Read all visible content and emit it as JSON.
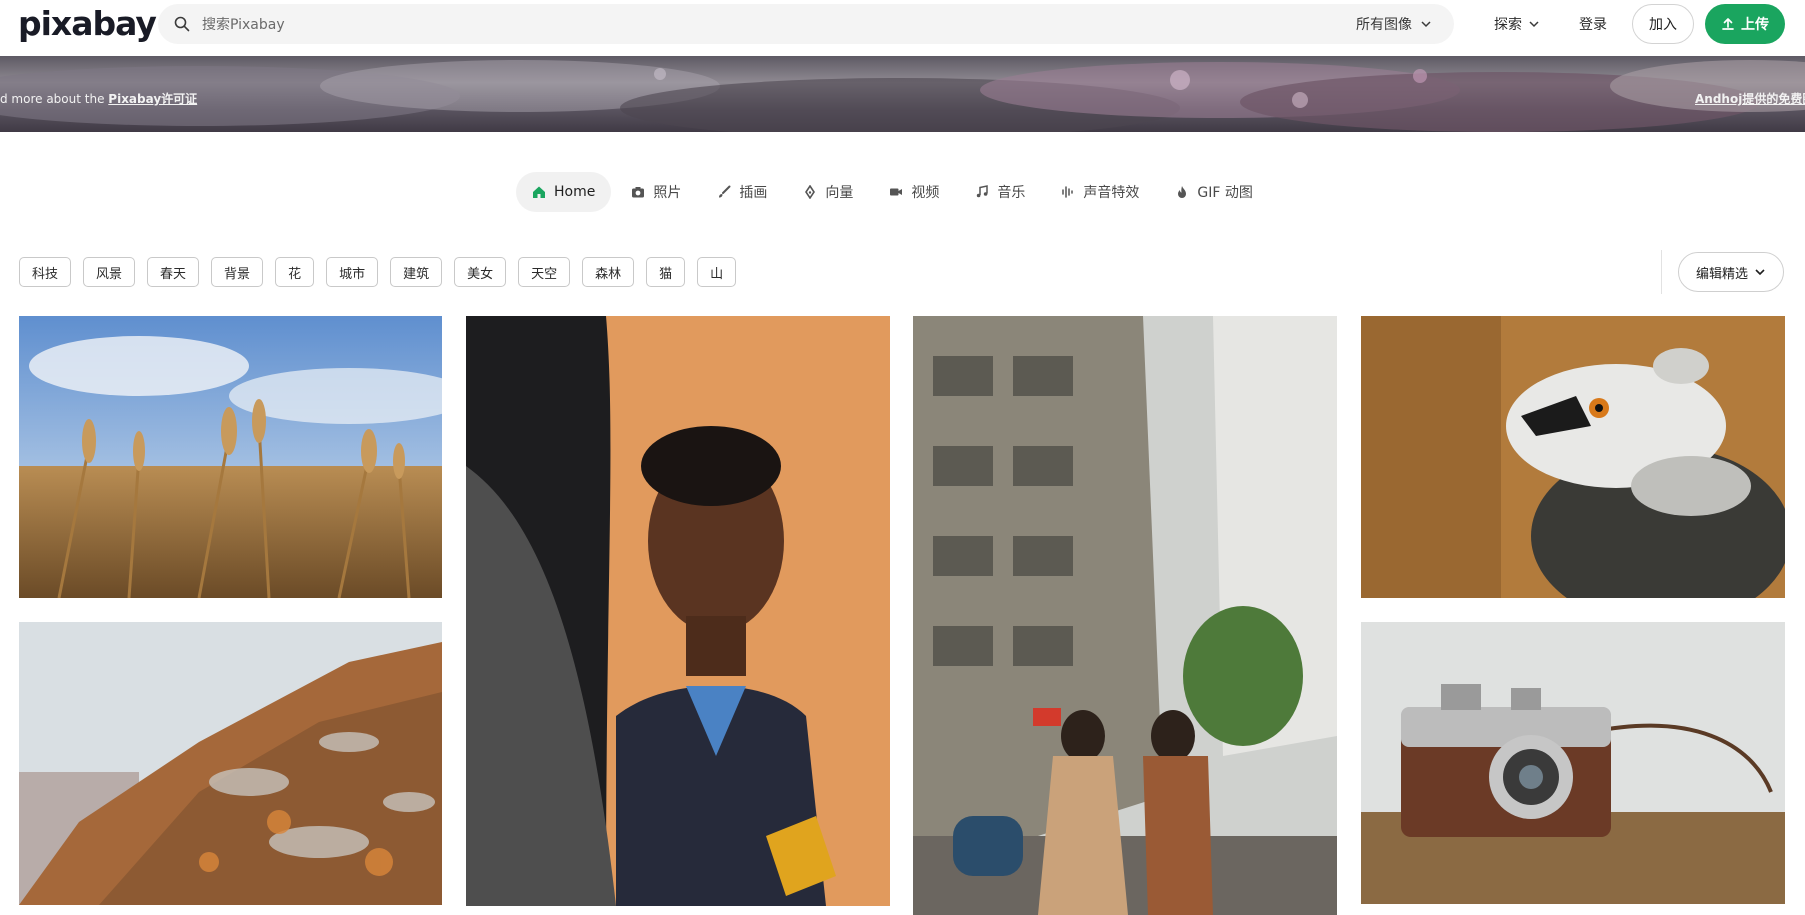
{
  "header": {
    "logo": "pixabay",
    "search_placeholder": "搜索Pixabay",
    "filter_label": "所有图像",
    "explore_label": "探索",
    "login_label": "登录",
    "join_label": "加入",
    "upload_label": "上传"
  },
  "banner": {
    "left_prefix": "d more about the ",
    "left_link": "Pixabay许可证",
    "right_text": "Andhoj提供的免费图像"
  },
  "tabs": [
    {
      "label": "Home",
      "icon": "home-icon",
      "active": true
    },
    {
      "label": "照片",
      "icon": "camera-icon"
    },
    {
      "label": "插画",
      "icon": "brush-icon"
    },
    {
      "label": "向量",
      "icon": "vector-pen-icon"
    },
    {
      "label": "视频",
      "icon": "video-icon"
    },
    {
      "label": "音乐",
      "icon": "music-icon"
    },
    {
      "label": "声音特效",
      "icon": "soundwave-icon"
    },
    {
      "label": "GIF 动图",
      "icon": "gif-flame-icon"
    }
  ],
  "tags": [
    "科技",
    "风景",
    "春天",
    "背景",
    "花",
    "城市",
    "建筑",
    "美女",
    "天空",
    "森林",
    "猫",
    "山"
  ],
  "sort_label": "编辑精选",
  "photos": [
    {
      "subject": "wheat-field"
    },
    {
      "subject": "lichen-rock"
    },
    {
      "subject": "young-man-portrait"
    },
    {
      "subject": "couple-street"
    },
    {
      "subject": "lemur"
    },
    {
      "subject": "vintage-camera"
    }
  ],
  "colors": {
    "accent": "#1aa55f",
    "text": "#1f1f1f",
    "tag_border": "#c9c9c9"
  }
}
